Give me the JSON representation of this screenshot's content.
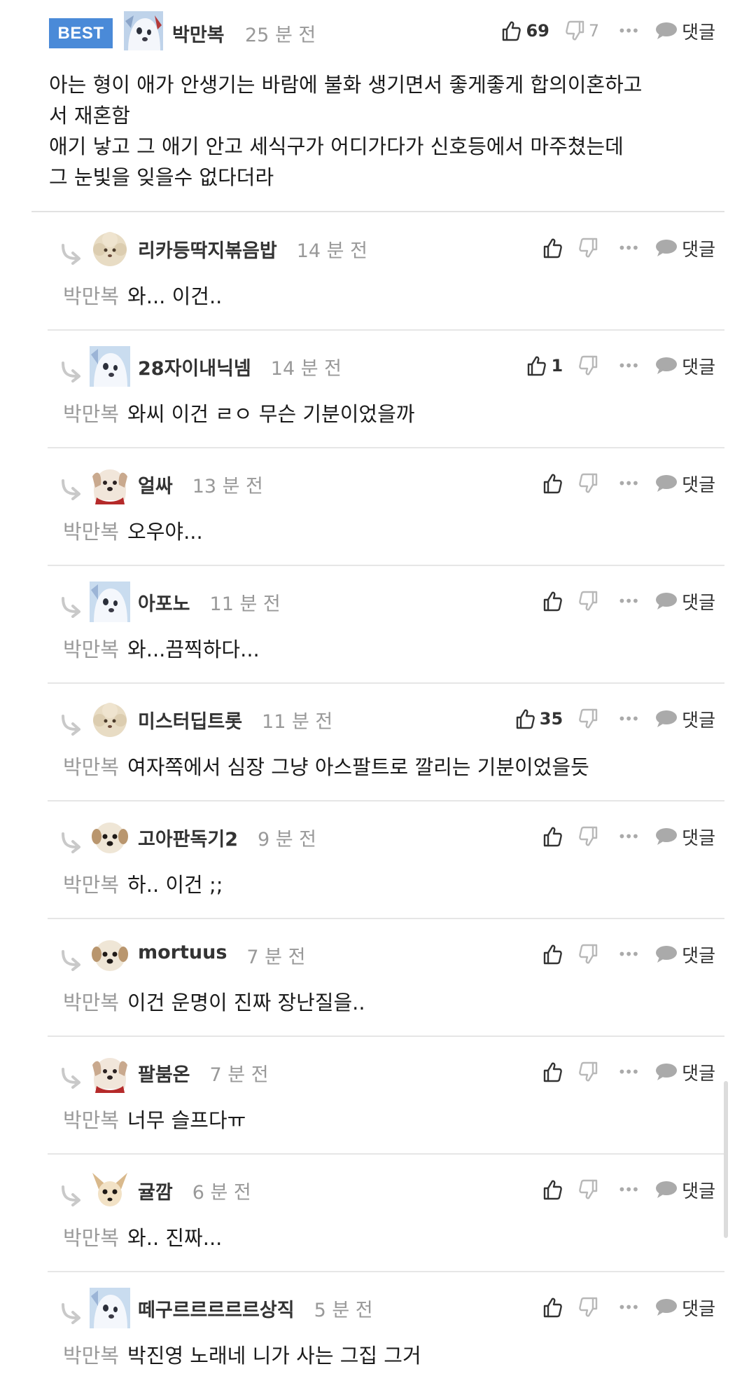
{
  "best": {
    "badge": "BEST",
    "author": "박만복",
    "time": "25 분 전",
    "likes": "69",
    "dislikes": "7",
    "more": "•••",
    "reply_label": "댓글",
    "body": [
      "아는 형이 애가 안생기는 바람에 불화 생기면서 좋게좋게 합의이혼하고",
      "서 재혼함",
      "애기 낳고 그 애기 안고 세식구가 어디가다가 신호등에서 마주쳤는데",
      "그 눈빛을 잊을수 없다더라"
    ]
  },
  "replies": [
    {
      "author": "리카등딱지볶음밥",
      "time": "14 분 전",
      "likes": "",
      "mention": "박만복",
      "text": "와... 이건..",
      "avatar": "poodle-avatar-icon"
    },
    {
      "author": "28자이내닉넴",
      "time": "14 분 전",
      "likes": "1",
      "mention": "박만복",
      "text": "와씨 이건 ㄹㅇ 무슨 기분이었을까",
      "avatar": "white-dog-avatar-icon"
    },
    {
      "author": "얼싸",
      "time": "13 분 전",
      "likes": "",
      "mention": "박만복",
      "text": "오우야...",
      "avatar": "dog-scarf-avatar-icon"
    },
    {
      "author": "아포노",
      "time": "11 분 전",
      "likes": "",
      "mention": "박만복",
      "text": "와...끔찍하다...",
      "avatar": "white-dog-avatar-icon"
    },
    {
      "author": "미스터딥트롯",
      "time": "11 분 전",
      "likes": "35",
      "mention": "박만복",
      "text": "여자쪽에서 심장 그냥 아스팔트로 깔리는 기분이었을듯",
      "avatar": "poodle-avatar-icon"
    },
    {
      "author": "고아판독기2",
      "time": "9 분 전",
      "likes": "",
      "mention": "박만복",
      "text": "하.. 이건 ;;",
      "avatar": "puppy-avatar-icon"
    },
    {
      "author": "mortuus",
      "time": "7 분 전",
      "likes": "",
      "mention": "박만복",
      "text": "이건 운명이 진짜 장난질을..",
      "avatar": "puppy-avatar-icon"
    },
    {
      "author": "팔붐온",
      "time": "7 분 전",
      "likes": "",
      "mention": "박만복",
      "text": "너무 슬프다ㅠ",
      "avatar": "dog-scarf-avatar-icon"
    },
    {
      "author": "귤깜",
      "time": "6 분 전",
      "likes": "",
      "mention": "박만복",
      "text": "와.. 진짜...",
      "avatar": "chihuahua-avatar-icon"
    },
    {
      "author": "떼구르르르르르상직",
      "time": "5 분 전",
      "likes": "",
      "mention": "박만복",
      "text": "박진영 노래네 니가 사는 그집 그거",
      "avatar": "white-dog-avatar-icon"
    }
  ],
  "ui": {
    "more": "•••",
    "reply_label": "댓글"
  },
  "colors": {
    "badge": "#4a8ad8",
    "muted": "#999999",
    "divider": "#e6e6e6"
  }
}
